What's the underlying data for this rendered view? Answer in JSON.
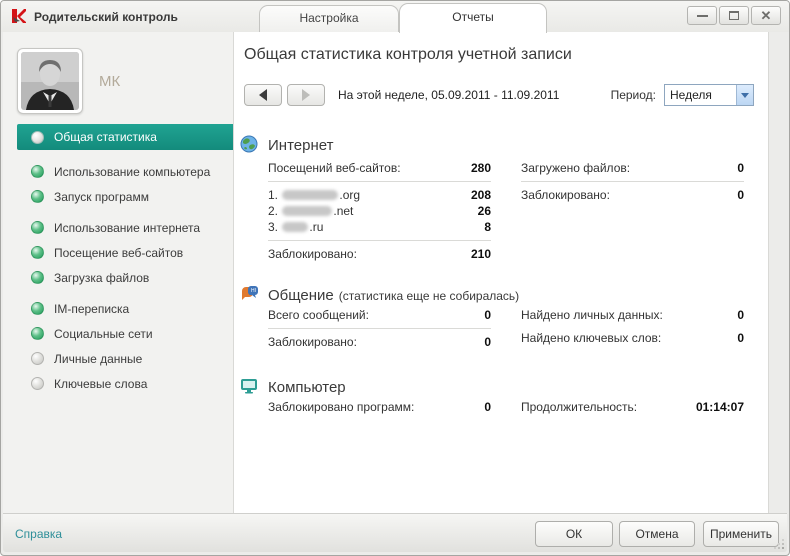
{
  "window": {
    "title": "Родительский контроль"
  },
  "tabs": [
    {
      "label": "Настройка",
      "active": false
    },
    {
      "label": "Отчеты",
      "active": true
    }
  ],
  "titlebar_icons": {
    "app_logo": "kaspersky-k-icon",
    "minimize": "minimize-icon",
    "maximize": "maximize-icon",
    "close": "close-icon"
  },
  "sidebar": {
    "user": {
      "name": "МК"
    },
    "items": [
      {
        "label": "Общая статистика",
        "bullet": "silver",
        "selected": true
      },
      {
        "label": "Использование компьютера",
        "bullet": "green",
        "selected": false
      },
      {
        "label": "Запуск программ",
        "bullet": "green",
        "selected": false
      },
      {
        "label": "Использование интернета",
        "bullet": "green",
        "selected": false
      },
      {
        "label": "Посещение веб-сайтов",
        "bullet": "green",
        "selected": false
      },
      {
        "label": "Загрузка файлов",
        "bullet": "green",
        "selected": false
      },
      {
        "label": "IM-переписка",
        "bullet": "green",
        "selected": false
      },
      {
        "label": "Социальные сети",
        "bullet": "green",
        "selected": false
      },
      {
        "label": "Личные данные",
        "bullet": "gray",
        "selected": false
      },
      {
        "label": "Ключевые слова",
        "bullet": "gray",
        "selected": false
      }
    ]
  },
  "header": {
    "title": "Общая статистика контроля учетной записи",
    "week_text": "На этой неделе, 05.09.2011 - 11.09.2011",
    "period_label": "Период:",
    "period_value": "Неделя"
  },
  "sections": {
    "internet": {
      "icon": "globe-icon",
      "title": "Интернет",
      "visits_label": "Посещений веб-сайтов:",
      "visits_value": "280",
      "top_sites": [
        {
          "rank": "1.",
          "suffix": ".org",
          "value": "208",
          "domain_redacted": true
        },
        {
          "rank": "2.",
          "suffix": ".net",
          "value": "26",
          "domain_redacted": true
        },
        {
          "rank": "3.",
          "suffix": ".ru",
          "value": "8",
          "domain_redacted": true
        }
      ],
      "blocked_label": "Заблокировано:",
      "blocked_value": "210",
      "downloaded_label": "Загружено файлов:",
      "downloaded_value": "0",
      "downloads_blocked_label": "Заблокировано:",
      "downloads_blocked_value": "0"
    },
    "communication": {
      "icon": "chat-bubbles-icon",
      "title": "Общение",
      "note": "(статистика еще не собиралась)",
      "messages_label": "Всего сообщений:",
      "messages_value": "0",
      "blocked_label": "Заблокировано:",
      "blocked_value": "0",
      "personal_data_label": "Найдено личных данных:",
      "personal_data_value": "0",
      "keywords_label": "Найдено ключевых слов:",
      "keywords_value": "0"
    },
    "computer": {
      "icon": "monitor-icon",
      "title": "Компьютер",
      "blocked_programs_label": "Заблокировано программ:",
      "blocked_programs_value": "0",
      "duration_label": "Продолжительность:",
      "duration_value": "01:14:07"
    }
  },
  "footer": {
    "help_label": "Справка",
    "ok_label": "ОК",
    "cancel_label": "Отмена",
    "apply_label": "Применить"
  },
  "colors": {
    "accent_teal": "#199b8b",
    "link_teal": "#2f8f99",
    "bullet_green": "#2fae6e",
    "bullet_gray": "#c6c6c3"
  }
}
